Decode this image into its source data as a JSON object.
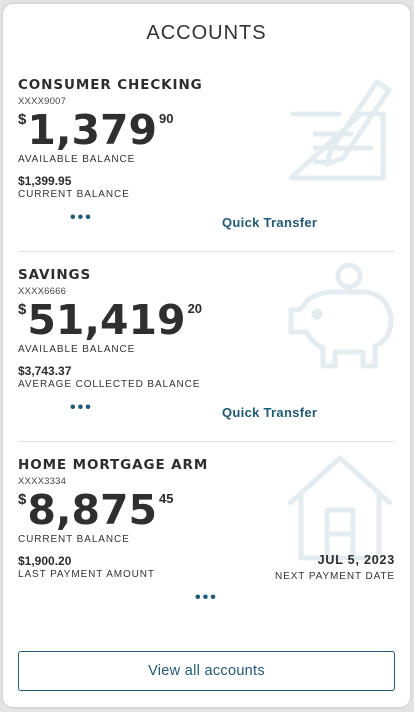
{
  "header": {
    "title": "ACCOUNTS"
  },
  "accounts": [
    {
      "name": "CONSUMER CHECKING",
      "number": "XXXX9007",
      "currency": "$",
      "amount_main": "1,379",
      "amount_cents": "90",
      "primary_label": "AVAILABLE BALANCE",
      "secondary_value": "$1,399.95",
      "secondary_label": "CURRENT BALANCE",
      "more": "•••",
      "action": "Quick Transfer",
      "icon": "check-icon"
    },
    {
      "name": "SAVINGS",
      "number": "XXXX6666",
      "currency": "$",
      "amount_main": "51,419",
      "amount_cents": "20",
      "primary_label": "AVAILABLE BALANCE",
      "secondary_value": "$3,743.37",
      "secondary_label": "AVERAGE COLLECTED BALANCE",
      "more": "•••",
      "action": "Quick Transfer",
      "icon": "piggy-bank-icon"
    },
    {
      "name": "HOME MORTGAGE ARM",
      "number": "XXXX3334",
      "currency": "$",
      "amount_main": "8,875",
      "amount_cents": "45",
      "primary_label": "CURRENT BALANCE",
      "secondary_value": "$1,900.20",
      "secondary_label": "LAST PAYMENT AMOUNT",
      "tertiary_value": "JUL 5, 2023",
      "tertiary_label": "NEXT PAYMENT DATE",
      "more": "•••",
      "icon": "house-icon"
    }
  ],
  "footer": {
    "view_all_label": "View all accounts"
  },
  "colors": {
    "accent": "#1e5a78",
    "icon": "#e3ecf1",
    "divider": "#e2e2e2"
  }
}
